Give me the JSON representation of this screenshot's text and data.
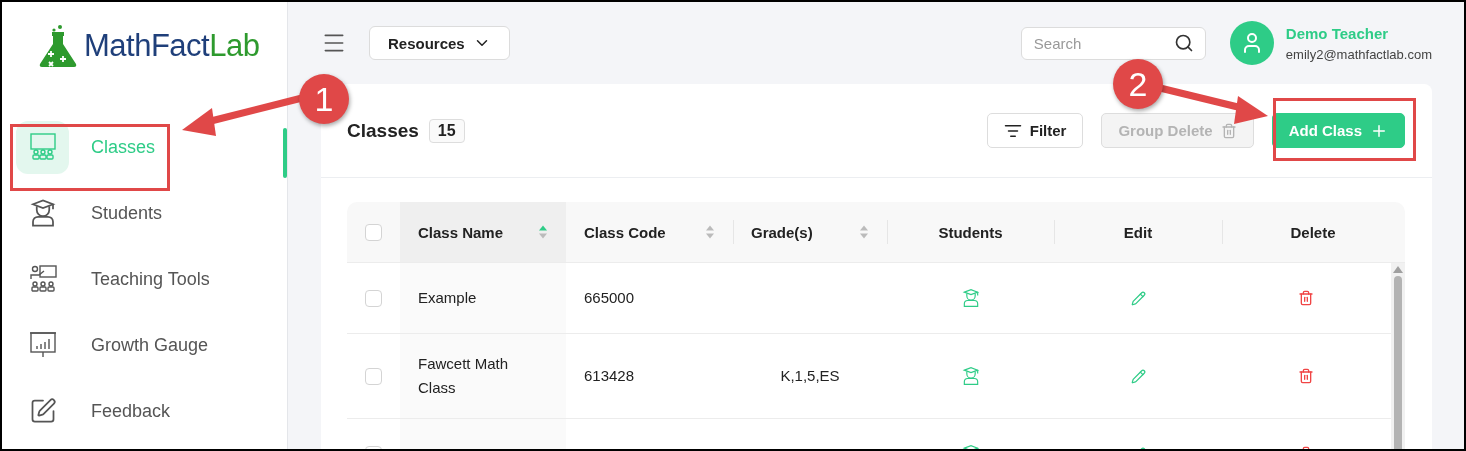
{
  "logo": {
    "text_main": "MathFact",
    "text_accent": "Lab"
  },
  "sidebar": {
    "items": [
      {
        "label": "Classes",
        "selected": true
      },
      {
        "label": "Students",
        "selected": false
      },
      {
        "label": "Teaching Tools",
        "selected": false
      },
      {
        "label": "Growth Gauge",
        "selected": false
      },
      {
        "label": "Feedback",
        "selected": false
      }
    ]
  },
  "topbar": {
    "resources": "Resources",
    "search": {
      "placeholder": "Search"
    },
    "user": {
      "name": "Demo Teacher",
      "email": "emily2@mathfactlab.com"
    }
  },
  "panel": {
    "title": "Classes",
    "count": "15",
    "buttons": [
      {
        "label": "Filter",
        "kind": "filter",
        "disabled": false
      },
      {
        "label": "Group Delete",
        "kind": "delete",
        "disabled": true
      },
      {
        "label": "Add Class",
        "kind": "add",
        "disabled": false
      }
    ]
  },
  "table": {
    "select_all": {
      "checked": false
    },
    "columns": [
      {
        "label": "Class Name",
        "sorted": true
      },
      {
        "label": "Class Code",
        "sorted": false
      },
      {
        "label": "Grade(s)",
        "sorted": false
      },
      {
        "label": "Students"
      },
      {
        "label": "Edit"
      },
      {
        "label": "Delete"
      }
    ],
    "rows": [
      {
        "checked": false,
        "name": "Example",
        "code": "665000"
      },
      {
        "checked": false,
        "name": "Fawcett Math Class",
        "code": "613428",
        "grades": "K,1,5,ES"
      },
      {
        "checked": false
      }
    ]
  },
  "annotations": [
    {
      "label": "1"
    },
    {
      "label": "2"
    }
  ]
}
